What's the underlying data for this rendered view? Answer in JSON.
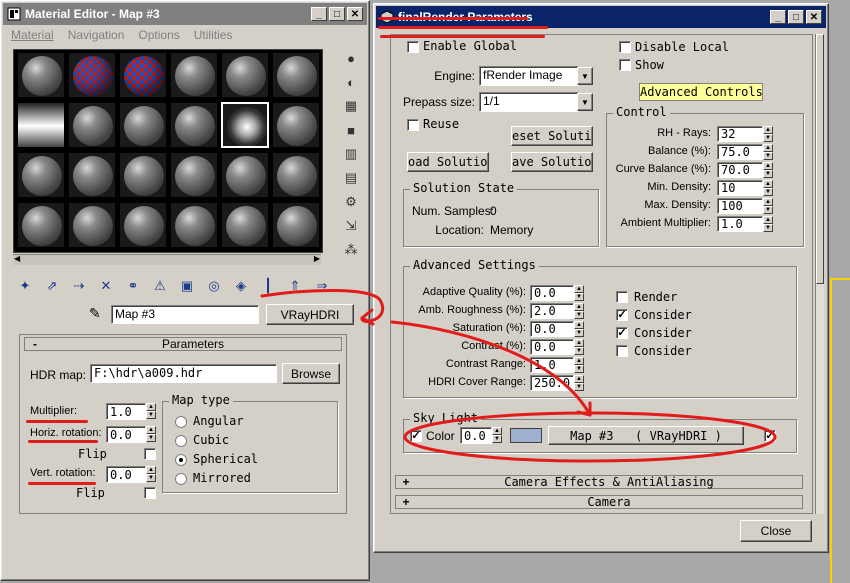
{
  "colors": {
    "title_active": "#0a246a",
    "title_inactive": "#808080",
    "annotation": "#e21b1b",
    "advanced_highlight": "#ffff99",
    "sky_swatch": "#9fb0d0"
  },
  "material_editor": {
    "title": "Material Editor - Map #3",
    "window_buttons": [
      "_",
      "□",
      "✕"
    ],
    "menu": [
      "Material",
      "Navigation",
      "Options",
      "Utilities"
    ],
    "slots": [
      "plain",
      "checker",
      "checker",
      "plain",
      "plain",
      "plain",
      "env",
      "plain",
      "plain",
      "plain",
      "hdri",
      "plain",
      "plain",
      "plain",
      "plain",
      "plain",
      "plain",
      "plain",
      "plain",
      "plain",
      "plain",
      "plain",
      "plain",
      "plain"
    ],
    "side_tools": [
      "sphere-icon",
      "backlight-icon",
      "checker-bg-icon",
      "bg-icon",
      "color-check-icon",
      "video-icon",
      "options-icon",
      "select-by-material-icon",
      "navigator-icon"
    ],
    "bottom_tools": [
      "get-material-icon",
      "put-to-scene-icon",
      "assign-icon",
      "reset-icon",
      "copy-icon",
      "unique-icon",
      "put-library-icon",
      "effects-channel-icon",
      "show-map-icon",
      "show-end-icon",
      "go-parent-icon",
      "go-sibling-icon"
    ],
    "map_name": "Map #3",
    "map_type_button": "VRayHDRI",
    "rollout_title": "Parameters",
    "rollout_sign": "-",
    "hdr_map_label": "HDR map:",
    "hdr_map_value": "F:\\hdr\\a009.hdr",
    "browse_label": "Browse",
    "multiplier_label": "Multiplier:",
    "multiplier_value": "1.0",
    "horiz_rotation_label": "Horiz. rotation:",
    "horiz_rotation_value": "0.0",
    "flip_label": "Flip",
    "vert_rotation_label": "Vert. rotation:",
    "vert_rotation_value": "0.0",
    "map_type_group": "Map type",
    "map_types": [
      {
        "label": "Angular",
        "selected": false
      },
      {
        "label": "Cubic",
        "selected": false
      },
      {
        "label": "Spherical",
        "selected": true
      },
      {
        "label": "Mirrored",
        "selected": false
      }
    ]
  },
  "final_render": {
    "title": "finalRender Parameters",
    "window_buttons": [
      "_",
      "□",
      "✕"
    ],
    "enable_global": "Enable Global",
    "disable_local": "Disable Local",
    "show": "Show",
    "advanced_controls": "Advanced Controls",
    "engine_label": "Engine:",
    "engine_value": "fRender Image",
    "prepass_label": "Prepass size:",
    "prepass_value": "1/1",
    "reuse": "Reuse",
    "reset_solution": "eset Solutio",
    "load_solution": "oad Solution",
    "save_solution": "ave Solution",
    "control_group": "Control",
    "control_fields": [
      {
        "label": "RH - Rays:",
        "value": "32"
      },
      {
        "label": "Balance (%):",
        "value": "75.0"
      },
      {
        "label": "Curve Balance (%):",
        "value": "70.0"
      },
      {
        "label": "Min. Density:",
        "value": "10"
      },
      {
        "label": "Max. Density:",
        "value": "100"
      },
      {
        "label": "Ambient Multiplier:",
        "value": "1.0"
      }
    ],
    "solution_state_group": "Solution State",
    "num_samples_label": "Num. Samples:",
    "num_samples_value": "0",
    "location_label": "Location:",
    "location_value": "Memory",
    "advanced_settings_group": "Advanced Settings",
    "advanced_fields": [
      {
        "label": "Adaptive Quality (%):",
        "value": "0.0"
      },
      {
        "label": "Amb. Roughness (%):",
        "value": "2.0"
      },
      {
        "label": "Saturation (%):",
        "value": "0.0"
      },
      {
        "label": "Contrast (%):",
        "value": "0.0"
      },
      {
        "label": "Contrast Range:",
        "value": "1.0"
      },
      {
        "label": "HDRI Cover Range:",
        "value": "250.0"
      }
    ],
    "advanced_checks": [
      {
        "label": "Render",
        "checked": false
      },
      {
        "label": "Consider",
        "checked": true
      },
      {
        "label": "Consider",
        "checked": true
      },
      {
        "label": "Consider",
        "checked": false
      }
    ],
    "sky_light_group": "Sky Light",
    "color_label": "Color",
    "color_value": "0.0",
    "sky_map_button": "Map #3   ( VRayHDRI )",
    "rollouts": [
      {
        "sign": "+",
        "label": "Camera Effects & AntiAliasing"
      },
      {
        "sign": "+",
        "label": "Camera"
      }
    ],
    "close": "Close"
  }
}
